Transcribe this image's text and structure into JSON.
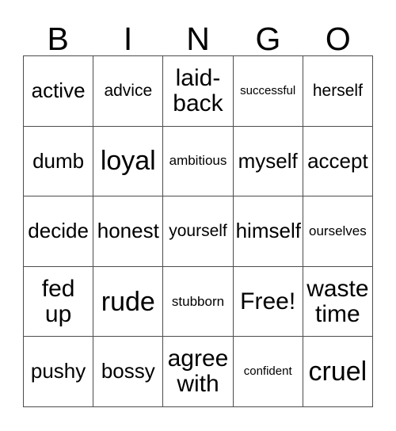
{
  "card": {
    "header_letters": [
      "B",
      "I",
      "N",
      "G",
      "O"
    ],
    "free_space_label": "Free!",
    "rows": [
      [
        {
          "text": "active",
          "size": "md"
        },
        {
          "text": "advice",
          "size": "sm"
        },
        {
          "text": "laid-\nback",
          "size": "lg"
        },
        {
          "text": "successful",
          "size": "xxs"
        },
        {
          "text": "herself",
          "size": "sm"
        }
      ],
      [
        {
          "text": "dumb",
          "size": "md"
        },
        {
          "text": "loyal",
          "size": "xl"
        },
        {
          "text": "ambitious",
          "size": "xs"
        },
        {
          "text": "myself",
          "size": "md"
        },
        {
          "text": "accept",
          "size": "md"
        }
      ],
      [
        {
          "text": "decide",
          "size": "md"
        },
        {
          "text": "honest",
          "size": "md"
        },
        {
          "text": "yourself",
          "size": "sm"
        },
        {
          "text": "himself",
          "size": "md"
        },
        {
          "text": "ourselves",
          "size": "xs"
        }
      ],
      [
        {
          "text": "fed\nup",
          "size": "lg"
        },
        {
          "text": "rude",
          "size": "xl"
        },
        {
          "text": "stubborn",
          "size": "xs"
        },
        {
          "text": "Free!",
          "size": "lg"
        },
        {
          "text": "waste\ntime",
          "size": "lg"
        }
      ],
      [
        {
          "text": "pushy",
          "size": "md"
        },
        {
          "text": "bossy",
          "size": "md"
        },
        {
          "text": "agree\nwith",
          "size": "lg"
        },
        {
          "text": "confident",
          "size": "xxs"
        },
        {
          "text": "cruel",
          "size": "xl"
        }
      ]
    ]
  }
}
